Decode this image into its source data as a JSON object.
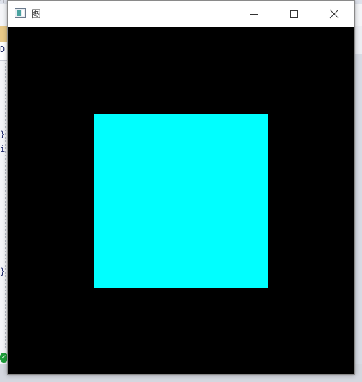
{
  "window": {
    "title": "图",
    "icon": "app-window-icon",
    "controls": {
      "minimize_icon": "minimize-icon",
      "maximize_icon": "maximize-icon",
      "close_icon": "close-icon"
    }
  },
  "canvas": {
    "background_color": "#000000",
    "shape": {
      "type": "square",
      "fill_color": "#00ffff"
    }
  },
  "background_ide": {
    "top_text": "4",
    "left_chars": [
      "D",
      "}",
      "i",
      "}"
    ],
    "status_icon": "check-icon"
  }
}
